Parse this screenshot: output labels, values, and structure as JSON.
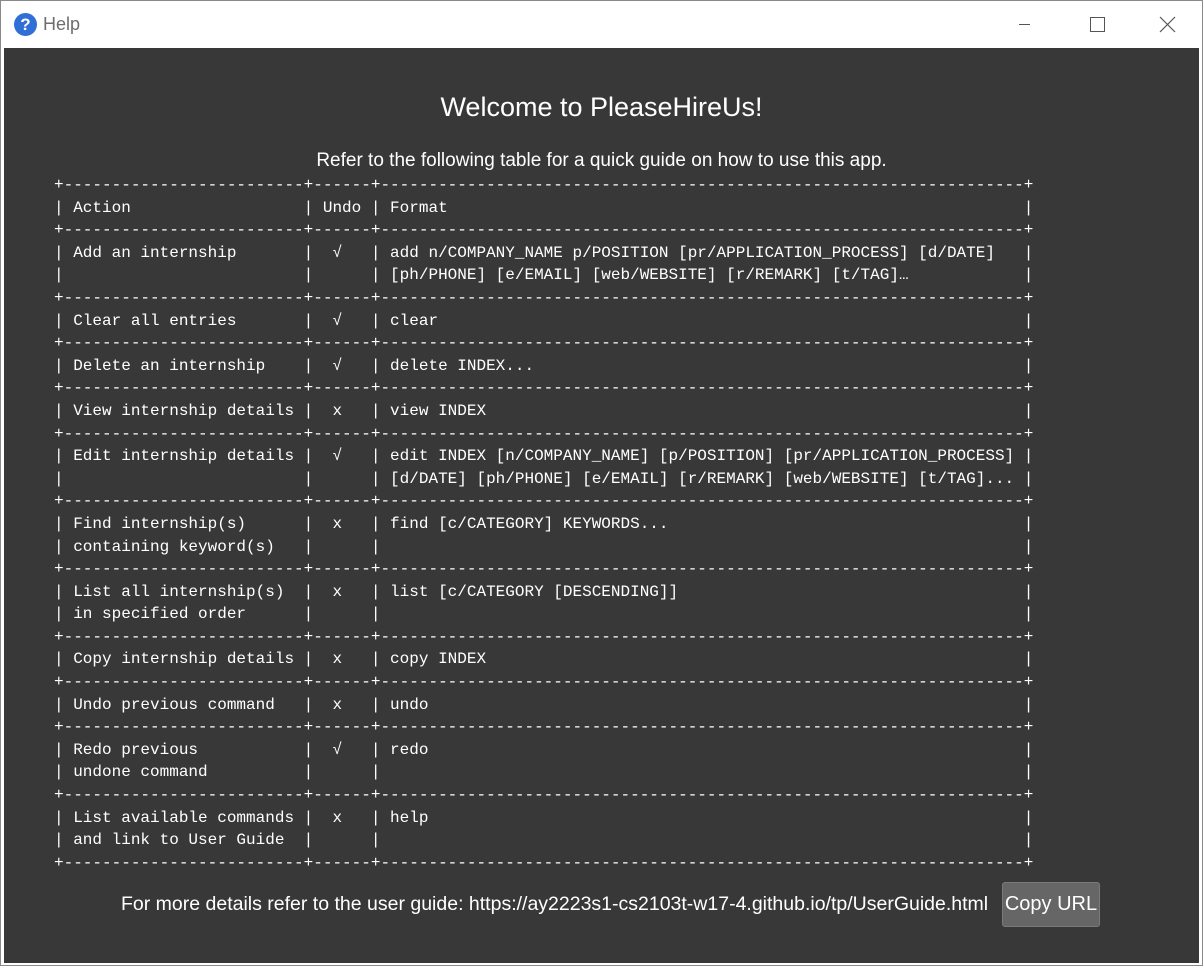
{
  "window": {
    "title": "Help",
    "icon": "question-mark-icon",
    "controls": [
      "minimize-icon",
      "maximize-icon",
      "close-icon"
    ]
  },
  "help": {
    "heading": "Welcome to PleaseHireUs!",
    "subheading": "Refer to the following table for a quick guide on how to use this app.",
    "table": {
      "headers": {
        "action": "Action",
        "undo": "Undo",
        "format": "Format"
      },
      "rows": [
        {
          "action": [
            "Add an internship"
          ],
          "undo": "√",
          "format": [
            "add n/COMPANY_NAME p/POSITION [pr/APPLICATION_PROCESS] [d/DATE]",
            "[ph/PHONE] [e/EMAIL] [web/WEBSITE] [r/REMARK] [t/TAG]…"
          ]
        },
        {
          "action": [
            "Clear all entries"
          ],
          "undo": "√",
          "format": [
            "clear"
          ]
        },
        {
          "action": [
            "Delete an internship"
          ],
          "undo": "√",
          "format": [
            "delete INDEX..."
          ]
        },
        {
          "action": [
            "View internship details"
          ],
          "undo": "x",
          "format": [
            "view INDEX"
          ]
        },
        {
          "action": [
            "Edit internship details"
          ],
          "undo": "√",
          "format": [
            "edit INDEX [n/COMPANY_NAME] [p/POSITION] [pr/APPLICATION_PROCESS]",
            "[d/DATE] [ph/PHONE] [e/EMAIL] [r/REMARK] [web/WEBSITE] [t/TAG]..."
          ]
        },
        {
          "action": [
            "Find internship(s)",
            "containing keyword(s)"
          ],
          "undo": "x",
          "format": [
            "find [c/CATEGORY] KEYWORDS..."
          ]
        },
        {
          "action": [
            "List all internship(s)",
            "in specified order"
          ],
          "undo": "x",
          "format": [
            "list [c/CATEGORY [DESCENDING]]"
          ]
        },
        {
          "action": [
            "Copy internship details"
          ],
          "undo": "x",
          "format": [
            "copy INDEX"
          ]
        },
        {
          "action": [
            "Undo previous command"
          ],
          "undo": "x",
          "format": [
            "undo"
          ]
        },
        {
          "action": [
            "Redo previous",
            "undone command"
          ],
          "undo": "√",
          "format": [
            "redo"
          ]
        },
        {
          "action": [
            "List available commands",
            "and link to User Guide"
          ],
          "undo": "x",
          "format": [
            "help"
          ]
        }
      ]
    },
    "footer": {
      "text": "For more details refer to the user guide: https://ay2223s1-cs2103t-w17-4.github.io/tp/UserGuide.html",
      "copy_button": "Copy URL"
    },
    "colors": {
      "background": "#383838",
      "text": "#ffffff",
      "button": "#666666",
      "accent": "#e8912d"
    }
  }
}
